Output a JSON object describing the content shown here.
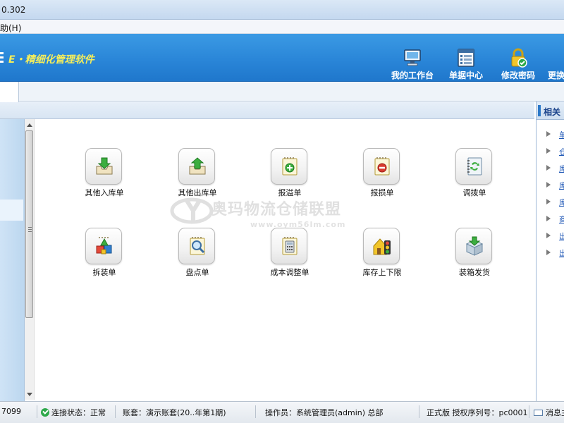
{
  "window": {
    "title_fragment": "0.302"
  },
  "menubar": {
    "item": "助(H)"
  },
  "header": {
    "brand": "E・精细化管理软件",
    "toolbar": [
      {
        "label": "我的工作台",
        "icon": "monitor-icon"
      },
      {
        "label": "单据中心",
        "icon": "document-list-icon"
      },
      {
        "label": "修改密码",
        "icon": "padlock-check-icon"
      },
      {
        "label": "更换",
        "icon": "switch-icon"
      }
    ]
  },
  "right_panel": {
    "title": "相关",
    "links": [
      "单",
      "仓",
      "库",
      "库",
      "库",
      "商",
      "出",
      "出"
    ]
  },
  "tiles": [
    {
      "label": "其他入库单",
      "icon": "inbound-tray-icon"
    },
    {
      "label": "其他出库单",
      "icon": "outbound-tray-icon"
    },
    {
      "label": "报溢单",
      "icon": "overflow-plus-icon"
    },
    {
      "label": "报损单",
      "icon": "loss-minus-icon"
    },
    {
      "label": "调拨单",
      "icon": "transfer-arrows-icon"
    },
    {
      "label": "拆装单",
      "icon": "blocks-icon"
    },
    {
      "label": "盘点单",
      "icon": "magnifier-icon"
    },
    {
      "label": "成本调整单",
      "icon": "calculator-icon"
    },
    {
      "label": "库存上下限",
      "icon": "traffic-light-icon"
    },
    {
      "label": "装箱发货",
      "icon": "packing-box-icon"
    }
  ],
  "watermark": {
    "line1": "奥玛物流仓储联盟",
    "line2": "www.oym56lm.com"
  },
  "status": {
    "code": "7099",
    "connection": "连接状态：正常",
    "account": "账套：演示账套(20..年第1期)",
    "operator": "操作员：系统管理员(admin) 总部",
    "license": "正式版 授权序列号：pc0001",
    "message": "消息主"
  },
  "colors": {
    "header_blue": "#2a86d8",
    "brand_yellow": "#f6ee5a",
    "link_blue": "#1d56b5",
    "status_ok": "#2da84a"
  }
}
